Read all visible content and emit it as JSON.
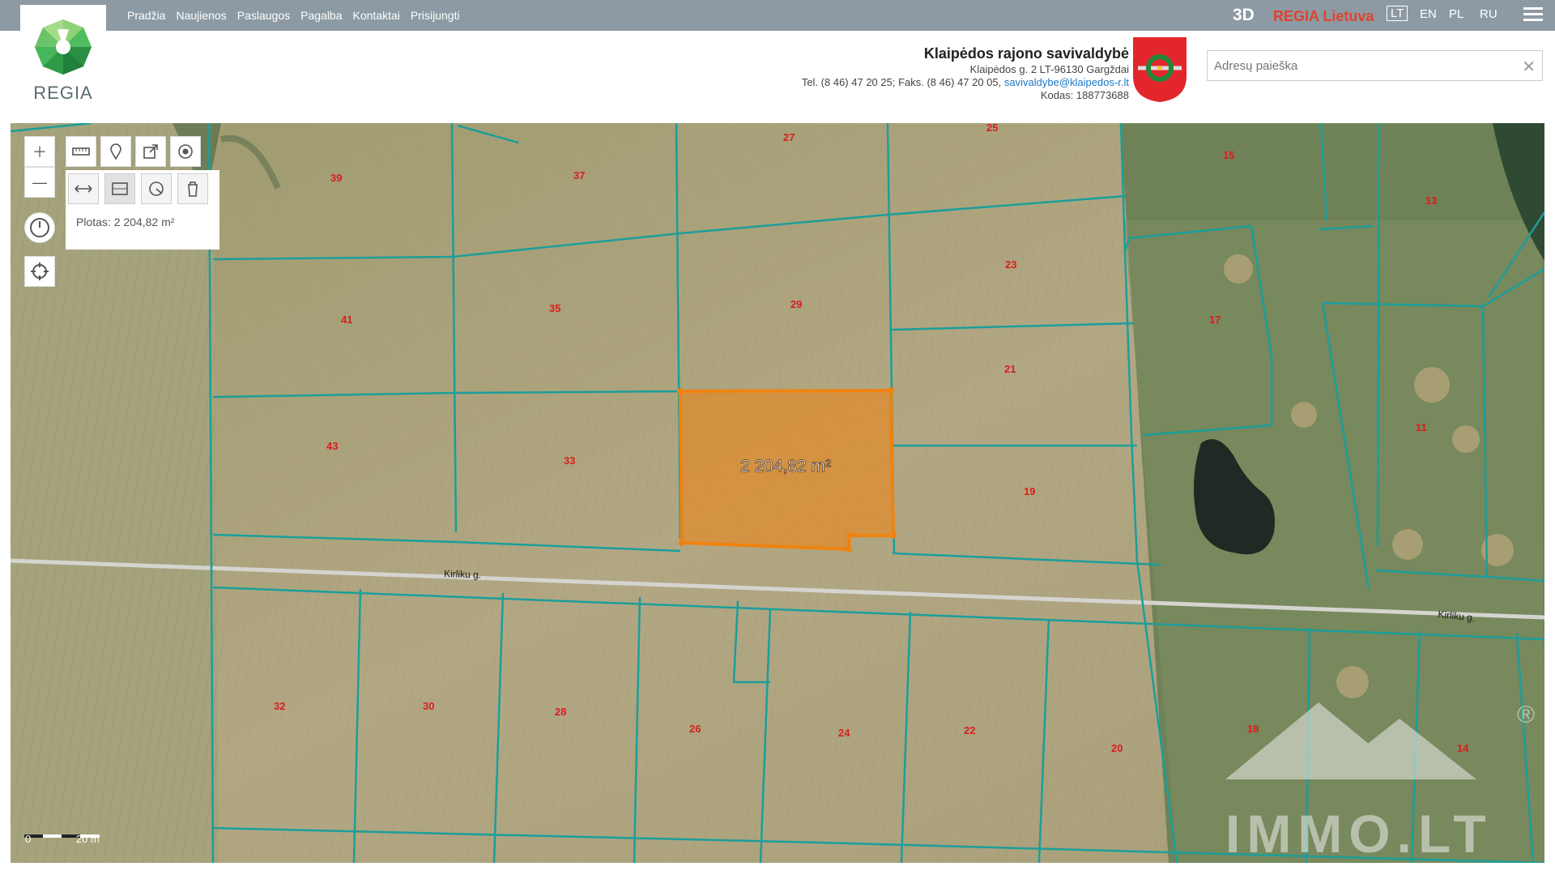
{
  "nav": {
    "items": [
      "Pradžia",
      "Naujienos",
      "Paslaugos",
      "Pagalba",
      "Kontaktai",
      "Prisijungti"
    ]
  },
  "logo": {
    "text": "REGIA"
  },
  "header": {
    "mode_3d": "3D",
    "regia_lietuva": "REGIA Lietuva",
    "languages": [
      "LT",
      "EN",
      "PL",
      "RU"
    ],
    "selected_language": "LT"
  },
  "municipality": {
    "name": "Klaipėdos rajono savivaldybė",
    "address": "Klaipėdos g. 2 LT-96130 Gargždai",
    "phones": "Tel. (8 46) 47 20 25; Faks. (8 46) 47 20 05,",
    "email": "savivaldybe@klaipedos-r.lt",
    "code": "Kodas: 188773688"
  },
  "search": {
    "placeholder": "Adresų paieška"
  },
  "measure": {
    "plotas": "Plotas: 2 204,82 m²",
    "area_label": "2 204,82 m²"
  },
  "parcels": [
    "39",
    "37",
    "27",
    "25",
    "15",
    "13",
    "41",
    "35",
    "29",
    "23",
    "17",
    "21",
    "43",
    "33",
    "19",
    "11",
    "32",
    "30",
    "28",
    "26",
    "24",
    "22",
    "20",
    "18",
    "14"
  ],
  "street": {
    "name": "Kirliku g."
  },
  "scale": {
    "zero": "0",
    "distance": "20 m"
  },
  "watermark": {
    "text": "IMMO.LT",
    "registered": "®"
  },
  "colors": {
    "parcel_line": "#1c9e9a",
    "selection": "#f0820f",
    "topbar": "#8d9aa3",
    "label": "#d81e1e"
  }
}
